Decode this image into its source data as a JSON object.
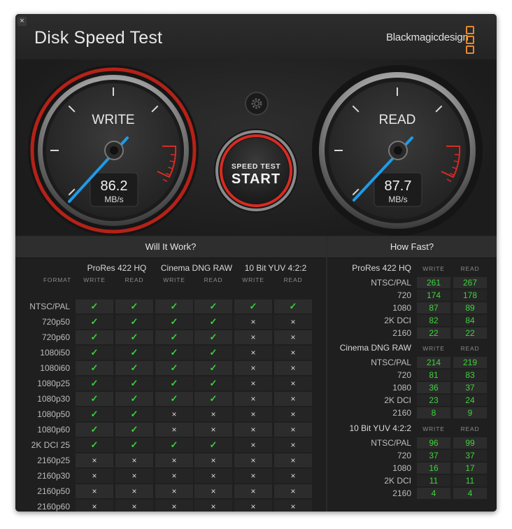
{
  "window": {
    "title": "Disk Speed Test",
    "brand": "Blackmagicdesign",
    "close_glyph": "×"
  },
  "gauges": {
    "write": {
      "label": "WRITE",
      "value": "86.2",
      "unit": "MB/s"
    },
    "read": {
      "label": "READ",
      "value": "87.7",
      "unit": "MB/s"
    }
  },
  "start_button": {
    "line1": "SPEED TEST",
    "line2": "START"
  },
  "settings_icon": "gear-icon",
  "colors": {
    "pass": "#37d43a",
    "accent_red": "#c8211b",
    "needle": "#1e9be8",
    "brand_orange": "#e68a2e"
  },
  "will_it_work": {
    "title": "Will It Work?",
    "format_label": "FORMAT",
    "codecs": [
      "ProRes 422 HQ",
      "Cinema DNG RAW",
      "10 Bit YUV 4:2:2"
    ],
    "sub_headers": [
      "WRITE",
      "READ"
    ],
    "rows": [
      {
        "format": "NTSC/PAL",
        "cells": [
          "✓",
          "✓",
          "✓",
          "✓",
          "✓",
          "✓"
        ]
      },
      {
        "format": "720p50",
        "cells": [
          "✓",
          "✓",
          "✓",
          "✓",
          "×",
          "×"
        ]
      },
      {
        "format": "720p60",
        "cells": [
          "✓",
          "✓",
          "✓",
          "✓",
          "×",
          "×"
        ]
      },
      {
        "format": "1080i50",
        "cells": [
          "✓",
          "✓",
          "✓",
          "✓",
          "×",
          "×"
        ]
      },
      {
        "format": "1080i60",
        "cells": [
          "✓",
          "✓",
          "✓",
          "✓",
          "×",
          "×"
        ]
      },
      {
        "format": "1080p25",
        "cells": [
          "✓",
          "✓",
          "✓",
          "✓",
          "×",
          "×"
        ]
      },
      {
        "format": "1080p30",
        "cells": [
          "✓",
          "✓",
          "✓",
          "✓",
          "×",
          "×"
        ]
      },
      {
        "format": "1080p50",
        "cells": [
          "✓",
          "✓",
          "×",
          "×",
          "×",
          "×"
        ]
      },
      {
        "format": "1080p60",
        "cells": [
          "✓",
          "✓",
          "×",
          "×",
          "×",
          "×"
        ]
      },
      {
        "format": "2K DCI 25",
        "cells": [
          "✓",
          "✓",
          "✓",
          "✓",
          "×",
          "×"
        ]
      },
      {
        "format": "2160p25",
        "cells": [
          "×",
          "×",
          "×",
          "×",
          "×",
          "×"
        ]
      },
      {
        "format": "2160p30",
        "cells": [
          "×",
          "×",
          "×",
          "×",
          "×",
          "×"
        ]
      },
      {
        "format": "2160p50",
        "cells": [
          "×",
          "×",
          "×",
          "×",
          "×",
          "×"
        ]
      },
      {
        "format": "2160p60",
        "cells": [
          "×",
          "×",
          "×",
          "×",
          "×",
          "×"
        ]
      }
    ]
  },
  "how_fast": {
    "title": "How Fast?",
    "sub_headers": [
      "WRITE",
      "READ"
    ],
    "groups": [
      {
        "codec": "ProRes 422 HQ",
        "rows": [
          {
            "format": "NTSC/PAL",
            "write": "261",
            "read": "267"
          },
          {
            "format": "720",
            "write": "174",
            "read": "178"
          },
          {
            "format": "1080",
            "write": "87",
            "read": "89"
          },
          {
            "format": "2K DCI",
            "write": "82",
            "read": "84"
          },
          {
            "format": "2160",
            "write": "22",
            "read": "22"
          }
        ]
      },
      {
        "codec": "Cinema DNG RAW",
        "rows": [
          {
            "format": "NTSC/PAL",
            "write": "214",
            "read": "219"
          },
          {
            "format": "720",
            "write": "81",
            "read": "83"
          },
          {
            "format": "1080",
            "write": "36",
            "read": "37"
          },
          {
            "format": "2K DCI",
            "write": "23",
            "read": "24"
          },
          {
            "format": "2160",
            "write": "8",
            "read": "9"
          }
        ]
      },
      {
        "codec": "10 Bit YUV 4:2:2",
        "rows": [
          {
            "format": "NTSC/PAL",
            "write": "96",
            "read": "99"
          },
          {
            "format": "720",
            "write": "37",
            "read": "37"
          },
          {
            "format": "1080",
            "write": "16",
            "read": "17"
          },
          {
            "format": "2K DCI",
            "write": "11",
            "read": "11"
          },
          {
            "format": "2160",
            "write": "4",
            "read": "4"
          }
        ]
      }
    ]
  }
}
